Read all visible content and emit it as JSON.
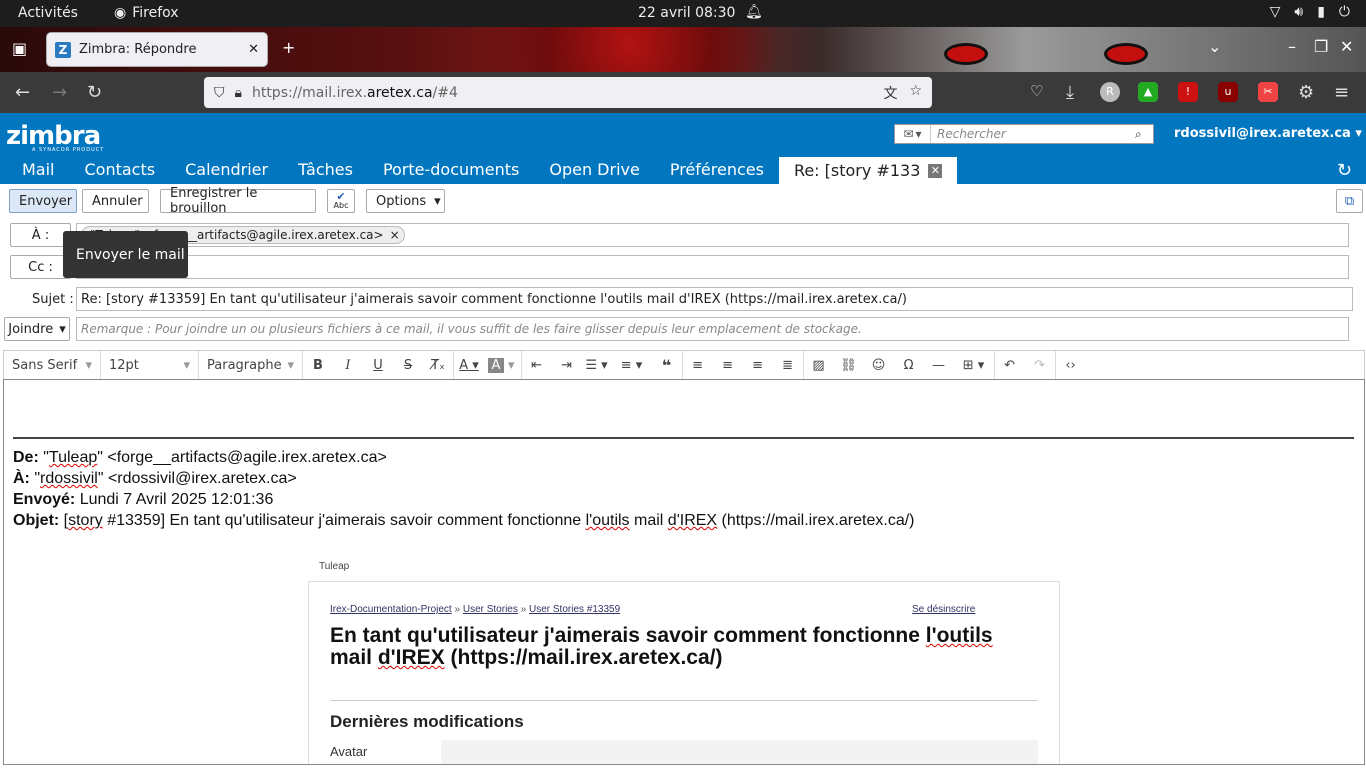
{
  "gnome": {
    "activities": "Activités",
    "app": "Firefox",
    "clock": "22 avril  08:30"
  },
  "browser": {
    "tab_title": "Zimbra: Répondre",
    "url_prefix": "https://mail.irex.",
    "url_domain": "aretex.ca",
    "url_suffix": "/#4"
  },
  "zimbra": {
    "logo": "zimbra",
    "logo_sub": "A SYNACOR PRODUCT",
    "search_placeholder": "Rechercher",
    "user": "rdossivil@irex.aretex.ca",
    "tabs": [
      {
        "label": "Mail"
      },
      {
        "label": "Contacts"
      },
      {
        "label": "Calendrier"
      },
      {
        "label": "Tâches"
      },
      {
        "label": "Porte-documents"
      },
      {
        "label": "Open Drive"
      },
      {
        "label": "Préférences"
      }
    ],
    "active_tab": "Re: [story #133"
  },
  "toolbar": {
    "send": "Envoyer",
    "cancel": "Annuler",
    "save_draft": "Enregistrer le brouillon",
    "spell": "Abc",
    "options": "Options",
    "tooltip": "Envoyer le mail"
  },
  "compose": {
    "to_label": "À :",
    "to_chip": "\"Tuleap\" <forge__artifacts@agile.irex.aretex.ca>",
    "cc_label": "Cc :",
    "subject_label": "Sujet :",
    "subject": "Re: [story #13359] En tant qu'utilisateur j'aimerais savoir comment fonctionne l'outils mail d'IREX (https://mail.irex.aretex.ca/)",
    "attach_label": "Joindre",
    "attach_placeholder": "Remarque : Pour joindre un ou plusieurs fichiers à ce mail, il vous suffit de les faire glisser depuis leur emplacement de stockage."
  },
  "editor_toolbar": {
    "font": "Sans Serif",
    "size": "12pt",
    "block": "Paragraphe"
  },
  "quoted": {
    "from_label": "De:",
    "from_pre": " \"",
    "from_name": "Tuleap",
    "from_post": "\" <forge__artifacts@agile.irex.aretex.ca>",
    "to_label": "À:",
    "to_pre": " \"",
    "to_name": "rdossivil",
    "to_post": "\" <rdossivil@irex.aretex.ca>",
    "sent_label": "Envoyé:",
    "sent": " Lundi 7 Avril 2025 12:01:36",
    "subject_label": "Objet:",
    "subject_a": " [",
    "subject_story": "story",
    "subject_b": " #13359] En tant qu'utilisateur j'aimerais savoir comment fonctionne ",
    "subject_outils": "l'outils",
    "subject_c": " mail ",
    "subject_irex": "d'IREX",
    "subject_d": " (https://mail.irex.aretex.ca/)"
  },
  "tuleap": {
    "sender": "Tuleap",
    "breadcrumb": [
      "Irex-Documentation-Project",
      "User Stories",
      "User Stories #13359"
    ],
    "unsubscribe": "Se désinscrire",
    "title_a": "En tant qu'utilisateur j'aimerais savoir comment fonctionne ",
    "title_outils": "l'outils",
    "title_b": " mail ",
    "title_irex": "d'IREX",
    "title_c": " (https://mail.irex.aretex.ca/)",
    "latest": "Dernières modifications",
    "avatar": "Avatar"
  }
}
